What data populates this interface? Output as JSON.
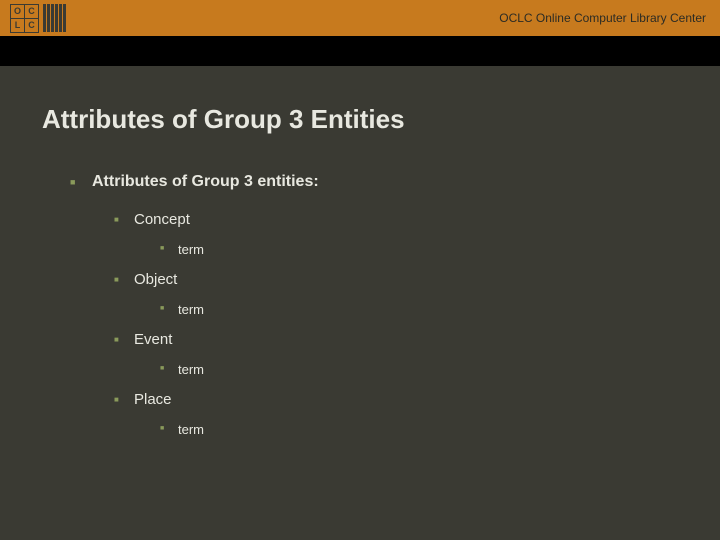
{
  "header": {
    "org_text": "OCLC Online Computer Library Center",
    "logo_letters": [
      "O",
      "C",
      "L",
      "C"
    ]
  },
  "slide": {
    "title": "Attributes of Group 3 Entities",
    "bullets_lvl1": [
      {
        "label": "Attributes of Group 3 entities:",
        "children": [
          {
            "label": "Concept",
            "children": [
              {
                "label": "term"
              }
            ]
          },
          {
            "label": "Object",
            "children": [
              {
                "label": "term"
              }
            ]
          },
          {
            "label": "Event",
            "children": [
              {
                "label": "term"
              }
            ]
          },
          {
            "label": "Place",
            "children": [
              {
                "label": "term"
              }
            ]
          }
        ]
      }
    ]
  }
}
